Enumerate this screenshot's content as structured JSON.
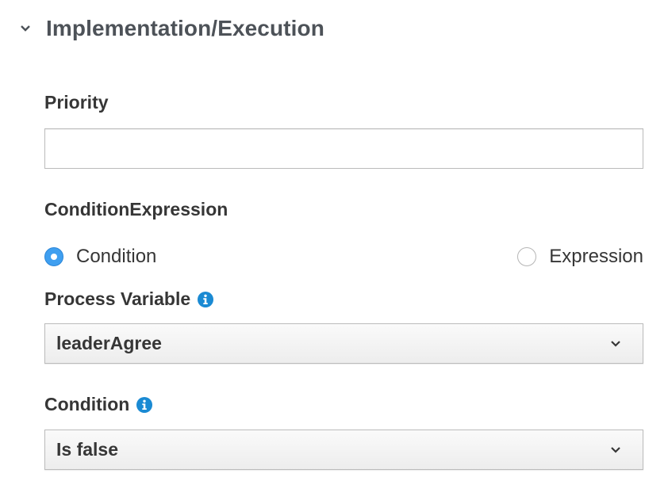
{
  "section": {
    "title": "Implementation/Execution"
  },
  "priority": {
    "label": "Priority",
    "value": ""
  },
  "condition_expression": {
    "label": "ConditionExpression",
    "options": [
      {
        "label": "Condition",
        "selected": true
      },
      {
        "label": "Expression",
        "selected": false
      }
    ]
  },
  "process_variable": {
    "label": "Process Variable",
    "value": "leaderAgree"
  },
  "condition": {
    "label": "Condition",
    "value": "Is false"
  },
  "colors": {
    "accent": "#3f9ff0",
    "info_icon": "#1a8ad3",
    "text": "#363636",
    "border": "#bbbbbb"
  },
  "icons": {
    "collapse": "chevron-down-icon",
    "info": "info-icon",
    "select_caret": "chevron-down-icon"
  }
}
